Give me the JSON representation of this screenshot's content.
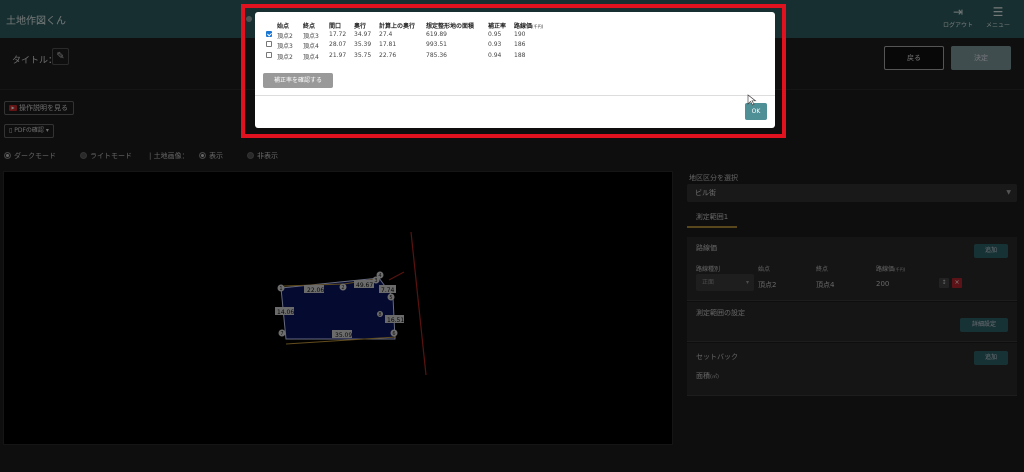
{
  "app": {
    "title": "土地作図くん"
  },
  "topbar": {
    "logout_label": "ログアウト",
    "menu_label": "メニュー"
  },
  "header": {
    "title_label": "タイトル：",
    "back_label": "戻る",
    "decide_label": "決定"
  },
  "toolbar": {
    "help_label": "操作説明を見る",
    "pdf_label": "PDFの確認",
    "dark_mode_label": "ダークモード",
    "light_mode_label": "ライトモード",
    "land_image_label": "土地画像：",
    "show_label": "表示",
    "hide_label": "非表示",
    "selected_mode": "ダークモード",
    "selected_image": "表示"
  },
  "canvas": {
    "dimension_labels": [
      "22.06",
      "49.67",
      "7.74",
      "14.06",
      "16.51",
      "35.09"
    ],
    "vertex_numbers": [
      "1",
      "2",
      "3",
      "4",
      "5",
      "6",
      "7",
      "8"
    ]
  },
  "right_panel": {
    "zone_label": "地区区分を選択",
    "zone_value": "ビル街",
    "range_tab": "測定範囲1",
    "road_section": {
      "title": "路線価",
      "add_label": "追加",
      "headers": {
        "type": "路線種別",
        "start": "始点",
        "end": "終点",
        "price": "路線価",
        "price_unit": "(千円)"
      },
      "row": {
        "type": "正面",
        "start": "頂点2",
        "end": "頂点4",
        "price": "200"
      }
    },
    "range_settings": {
      "title": "測定範囲の設定",
      "detail_label": "詳細設定"
    },
    "setback": {
      "title": "セットバック",
      "add_label": "追加",
      "area_label": "面積",
      "area_unit": "(㎡)"
    }
  },
  "modal": {
    "headers": {
      "start": "始点",
      "end": "終点",
      "frontage": "間口",
      "depth": "奥行",
      "calc_depth": "計算上の奥行",
      "assumed_area": "想定整形地の面積",
      "correction": "補正率",
      "road_price": "路線価",
      "price_unit": "(千円)"
    },
    "rows": [
      {
        "checked": true,
        "start": "頂点2",
        "end": "頂点3",
        "frontage": "17.72",
        "depth": "34.97",
        "calc_depth": "27.4",
        "area": "619.89",
        "correction": "0.95",
        "price": "190"
      },
      {
        "checked": false,
        "start": "頂点3",
        "end": "頂点4",
        "frontage": "28.07",
        "depth": "35.39",
        "calc_depth": "17.81",
        "area": "993.51",
        "correction": "0.93",
        "price": "186"
      },
      {
        "checked": false,
        "start": "頂点2",
        "end": "頂点4",
        "frontage": "21.97",
        "depth": "35.75",
        "calc_depth": "22.76",
        "area": "785.36",
        "correction": "0.94",
        "price": "188"
      }
    ],
    "confirm_label": "補正率を確認する",
    "ok_label": "OK"
  },
  "colors": {
    "header_bg": "#2f5f63",
    "highlight": "#e0121f",
    "ok": "#4f8f96",
    "checkbox": "#1976d2",
    "parcel_fill": "#0b1560"
  },
  "icons": {
    "logout": "logout-icon",
    "menu": "hamburger-menu-icon",
    "edit": "pencil-icon",
    "help": "video-icon",
    "pdf": "document-icon",
    "cursor": "mouse-pointer-icon"
  }
}
